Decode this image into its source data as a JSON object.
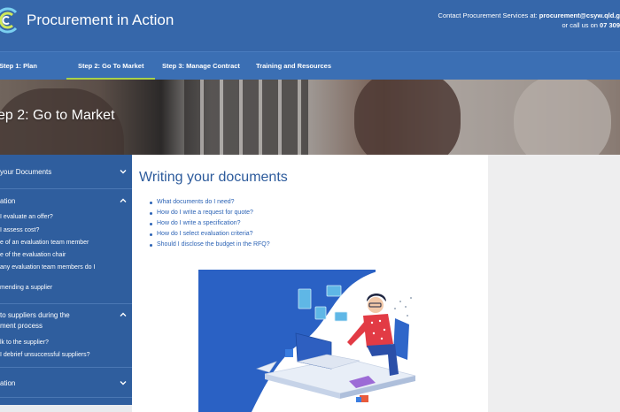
{
  "header": {
    "site_title": "Procurement in Action",
    "contact_prefix": "Contact Procurement Services at: ",
    "contact_email": "procurement@csyw.qld.g",
    "contact_line2_prefix": "or call us on ",
    "contact_phone": "07 309"
  },
  "nav": {
    "items": [
      {
        "label": "Step 1: Plan"
      },
      {
        "label": "Step 2: Go To Market"
      },
      {
        "label": "Step 3: Manage Contract"
      },
      {
        "label": "Training and Resources"
      }
    ],
    "active_index": 1
  },
  "hero": {
    "title": "ep 2: Go to Market"
  },
  "sidebar": {
    "sections": [
      {
        "label": "your Documents",
        "expanded": false
      },
      {
        "label": "ation",
        "expanded": true
      },
      {
        "label": "to suppliers during the",
        "label_line2": "ment process",
        "expanded": true
      },
      {
        "label": "ation",
        "expanded": false
      }
    ],
    "section2_links": [
      {
        "label": "I evaluate an offer?"
      },
      {
        "label": "I assess cost?"
      },
      {
        "label": "e of an evaluation team member"
      },
      {
        "label": "e of the evaluation chair"
      },
      {
        "label": "any evaluation team members do I"
      },
      {
        "label": "mending a supplier"
      }
    ],
    "section3_links": [
      {
        "label": "lk to the supplier?"
      },
      {
        "label": "I debrief unsuccessful suppliers?"
      }
    ]
  },
  "main": {
    "title": "Writing your documents",
    "links": [
      {
        "label": "What documents do I need?"
      },
      {
        "label": "How do I write a request for quote?"
      },
      {
        "label": "How do I write a specification?"
      },
      {
        "label": "How do I select evaluation criteria?"
      },
      {
        "label": "Should I disclose the budget in the RFQ?"
      }
    ]
  },
  "colors": {
    "header_bg": "#3667aa",
    "nav_bg": "#3b6fb4",
    "nav_active_underline": "#a8d24a",
    "sidebar_bg": "#2f5e9e",
    "heading": "#2d5b9c",
    "link": "#2c63b5",
    "illustration_blue": "#2a61c4",
    "shirt_red": "#e23b45"
  },
  "icons": {
    "logo": "circular-c-logo-icon",
    "chevron_down": "chevron-down-icon",
    "chevron_up": "chevron-up-icon"
  }
}
